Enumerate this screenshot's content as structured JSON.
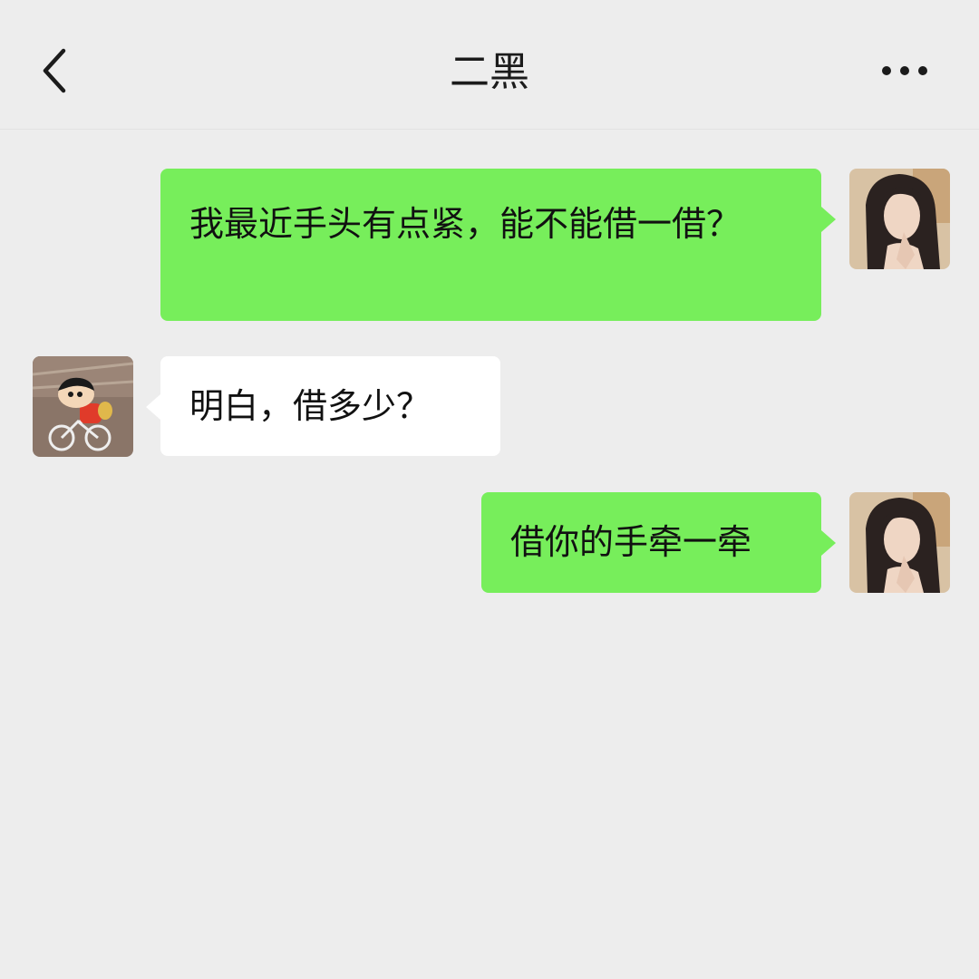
{
  "header": {
    "title": "二黑",
    "back_icon": "chevron-left-icon",
    "more_icon": "more-dots-icon"
  },
  "messages": [
    {
      "sender": "me",
      "text": "我最近手头有点紧，能不能借一借？"
    },
    {
      "sender": "contact",
      "text": "明白，借多少？"
    },
    {
      "sender": "me",
      "text": "借你的手牵一牵"
    }
  ],
  "colors": {
    "background": "#ededed",
    "my_bubble": "#77ee5b",
    "their_bubble": "#ffffff",
    "text": "#111111"
  }
}
